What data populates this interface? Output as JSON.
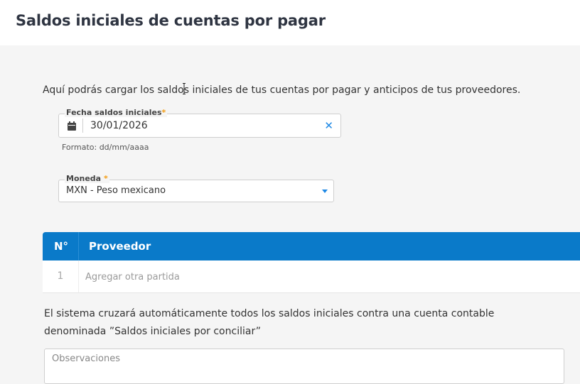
{
  "header": {
    "title": "Saldos iniciales de cuentas por pagar"
  },
  "intro": "Aquí podrás cargar los saldos iniciales de tus cuentas por pagar y anticipos de tus proveedores.",
  "date_field": {
    "label": "Fecha saldos iniciales",
    "required_mark": "*",
    "value": "30/01/2026",
    "clear_glyph": "✕",
    "hint": "Formato: dd/mm/aaaa",
    "icon": "calendar-icon"
  },
  "currency_field": {
    "label": "Moneda",
    "required_mark": "*",
    "value": "MXN - Peso mexicano",
    "icon": "chevron-down-icon"
  },
  "table": {
    "columns": [
      "N°",
      "Proveedor"
    ],
    "rows": [
      {
        "num": "1",
        "action": "Agregar otra partida"
      }
    ]
  },
  "note": "El sistema cruzará automáticamente todos los saldos iniciales contra una cuenta contable denominada ”Saldos iniciales por conciliar”",
  "observations": {
    "placeholder": "Observaciones"
  },
  "colors": {
    "accent": "#0a7ac9",
    "required": "#f39c12",
    "clear": "#1e88e5"
  }
}
